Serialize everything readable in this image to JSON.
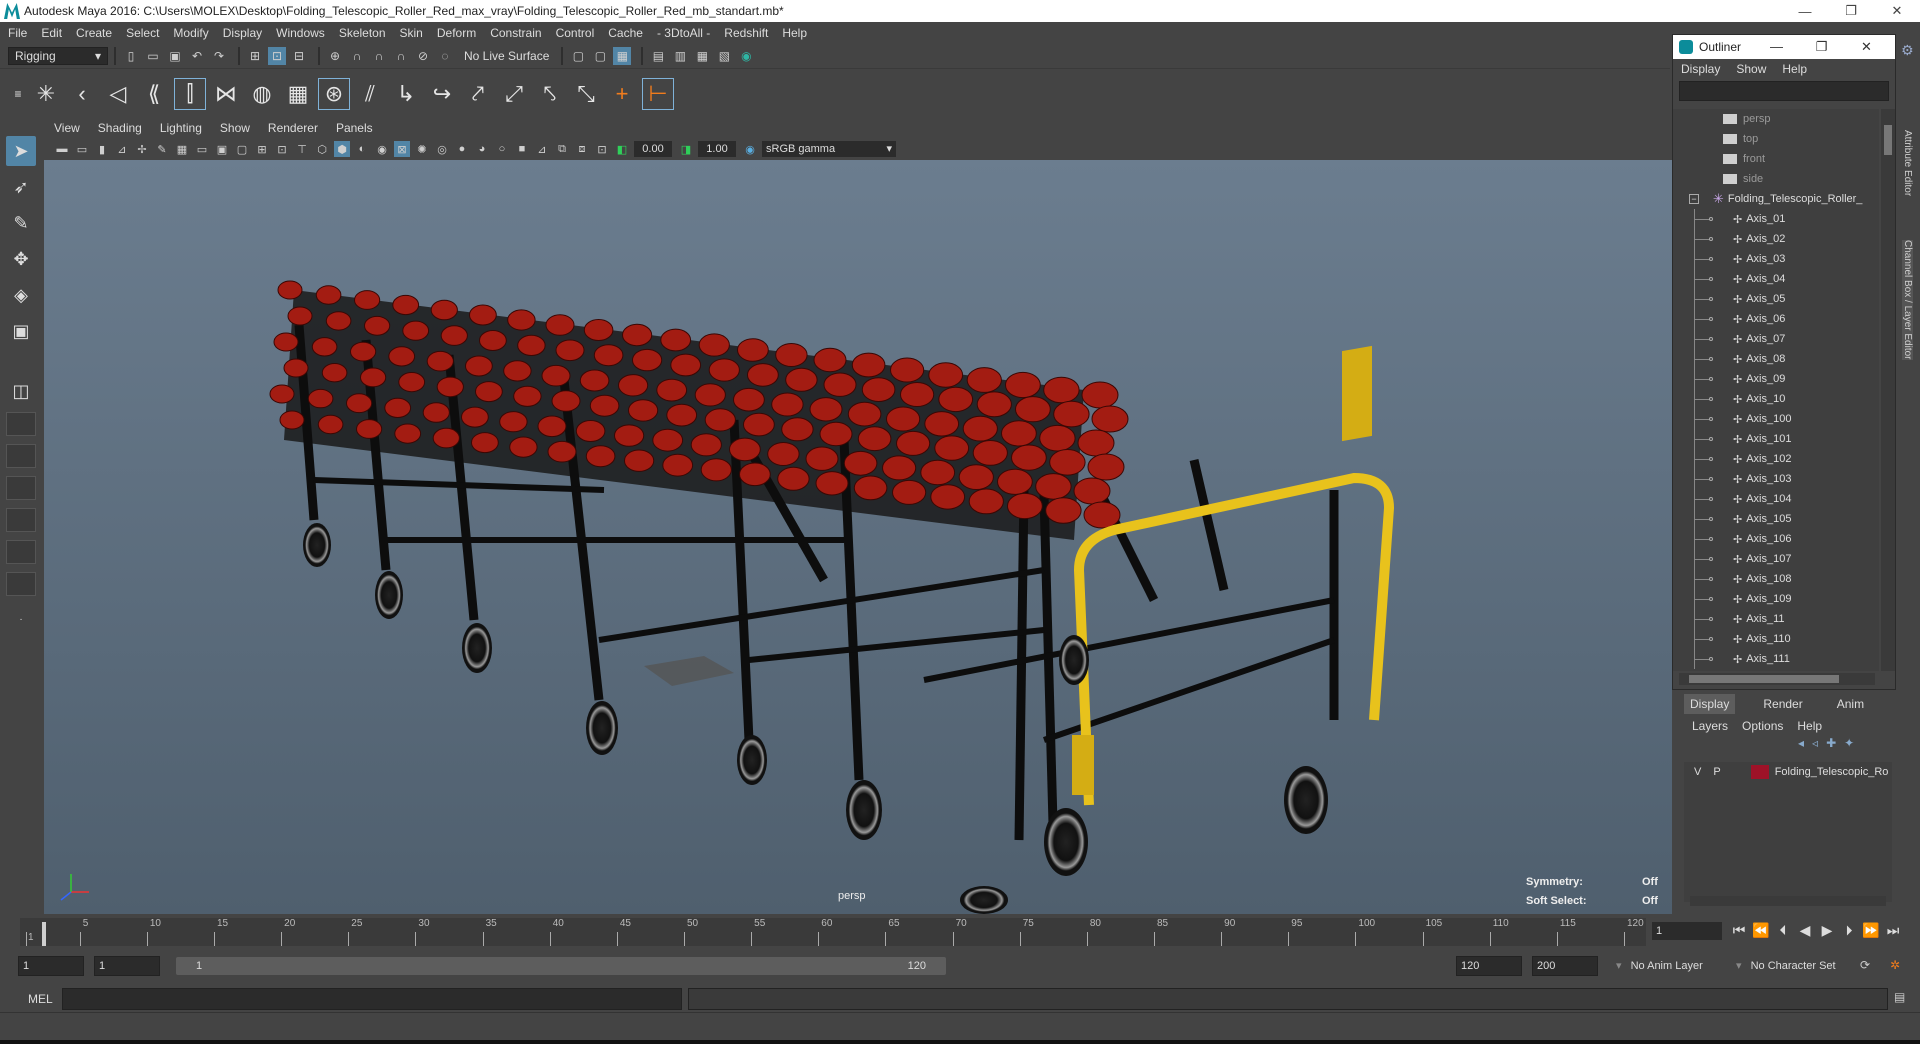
{
  "window": {
    "title": "Autodesk Maya 2016: C:\\Users\\MOLEX\\Desktop\\Folding_Telescopic_Roller_Red_max_vray\\Folding_Telescopic_Roller_Red_mb_standart.mb*",
    "minimize": "—",
    "maximize": "❐",
    "close": "✕"
  },
  "menubar": [
    "File",
    "Edit",
    "Create",
    "Select",
    "Modify",
    "Display",
    "Windows",
    "Skeleton",
    "Skin",
    "Deform",
    "Constrain",
    "Control",
    "Cache",
    "- 3DtoAll -",
    "Redshift",
    "Help"
  ],
  "statusline": {
    "mode": "Rigging",
    "live_surface": "No Live Surface"
  },
  "viewport": {
    "menu": [
      "View",
      "Shading",
      "Lighting",
      "Show",
      "Renderer",
      "Panels"
    ],
    "exposure": "0.00",
    "gamma": "1.00",
    "color_space": "sRGB gamma",
    "camera": "persp",
    "hud": {
      "symmetry_label": "Symmetry:",
      "symmetry_value": "Off",
      "soft_select_label": "Soft Select:",
      "soft_select_value": "Off"
    }
  },
  "outliner": {
    "title": "Outliner",
    "menu": [
      "Display",
      "Show",
      "Help"
    ],
    "cameras": [
      "persp",
      "top",
      "front",
      "side"
    ],
    "group": "Folding_Telescopic_Roller_",
    "items": [
      "Axis_01",
      "Axis_02",
      "Axis_03",
      "Axis_04",
      "Axis_05",
      "Axis_06",
      "Axis_07",
      "Axis_08",
      "Axis_09",
      "Axis_10",
      "Axis_100",
      "Axis_101",
      "Axis_102",
      "Axis_103",
      "Axis_104",
      "Axis_105",
      "Axis_106",
      "Axis_107",
      "Axis_108",
      "Axis_109",
      "Axis_11",
      "Axis_110",
      "Axis_111"
    ]
  },
  "side_tabs": [
    "Attribute Editor",
    "Channel Box / Layer Editor"
  ],
  "layer_editor": {
    "tabs": [
      "Display",
      "Render",
      "Anim"
    ],
    "menu": [
      "Layers",
      "Options",
      "Help"
    ],
    "layer": {
      "v": "V",
      "p": "P",
      "name": "Folding_Telescopic_Ro",
      "color": "#9e1228"
    }
  },
  "timeline": {
    "ticks": [
      "1",
      "5",
      "10",
      "15",
      "20",
      "25",
      "30",
      "35",
      "40",
      "45",
      "50",
      "55",
      "60",
      "65",
      "70",
      "75",
      "80",
      "85",
      "90",
      "95",
      "100",
      "105",
      "110",
      "115",
      "120"
    ],
    "current_frame": "1"
  },
  "range": {
    "start": "1",
    "inner_start": "1",
    "slider_start": "1",
    "slider_end": "120",
    "end": "120",
    "outer_end": "200",
    "anim_layer": "No Anim Layer",
    "char_set": "No Character Set"
  },
  "command": {
    "label": "MEL"
  },
  "colors": {
    "roller_red": "#a31c12",
    "frame_black": "#111111",
    "handle_yellow": "#e8c21c",
    "accent": "#5285a6"
  }
}
